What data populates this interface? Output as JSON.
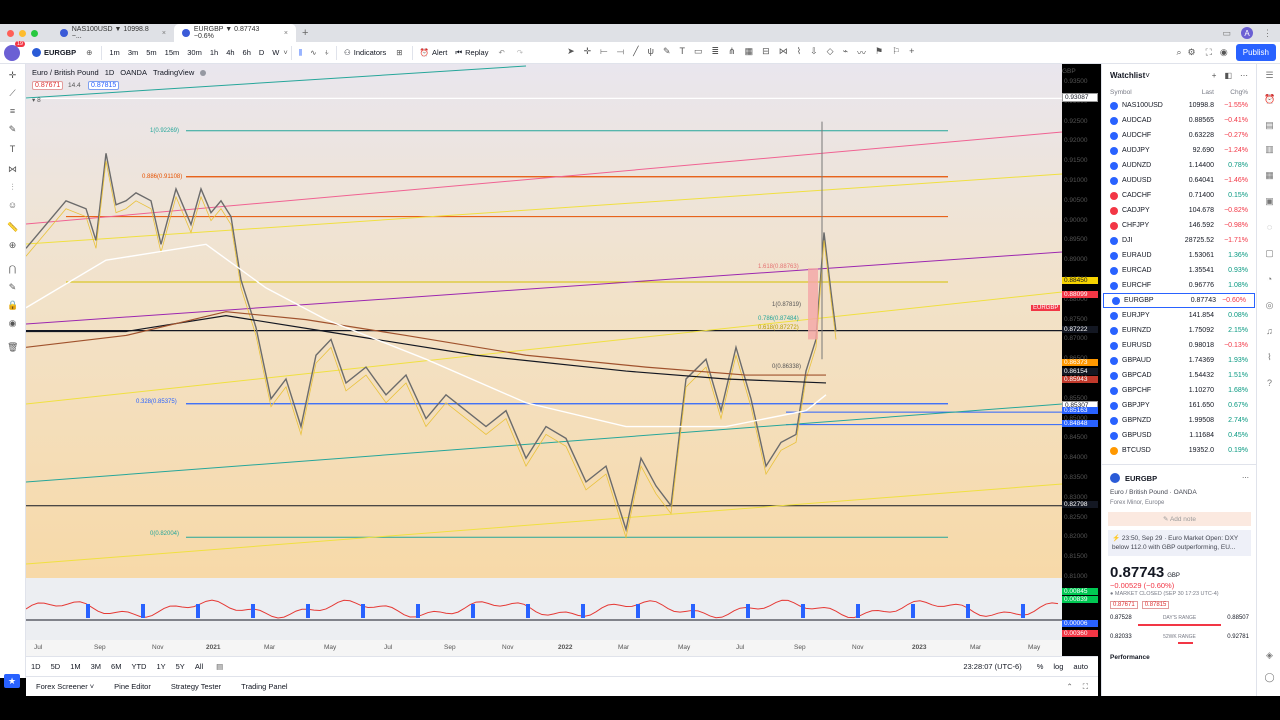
{
  "browser": {
    "tabs": [
      {
        "label": "NAS100USD ▼ 10998.8 −...",
        "active": false
      },
      {
        "label": "EURGBP ▼ 0.87743 −0.6%",
        "active": true
      }
    ],
    "new_tab": "+",
    "avatar_letter": "A"
  },
  "toolbar": {
    "symbol": "EURGBP",
    "intervals": [
      "1m",
      "3m",
      "5m",
      "15m",
      "30m",
      "1h",
      "4h",
      "6h",
      "D",
      "W"
    ],
    "indicators_label": "Indicators",
    "alert_label": "Alert",
    "replay_label": "Replay",
    "publish_label": "Publish",
    "notif_count": "19"
  },
  "chart": {
    "legend_title": "Euro / British Pound",
    "legend_interval": "1D",
    "legend_source": "OANDA",
    "legend_brand": "TradingView",
    "bid": "0.87671",
    "spread": "14.4",
    "ask": "0.87815",
    "indicator_count": "8",
    "currency": "GBP",
    "fib_labels": [
      "1(0.92269)",
      "0.886(0.91108)",
      "1.618(0.88763)",
      "1(0.87819)",
      "0.786(0.87484)",
      "0.618(0.87272)",
      "0(0.86338)",
      "0.328(0.85375)",
      "0(0.82004)"
    ],
    "price_ticks": [
      "0.93500",
      "0.93000",
      "0.92500",
      "0.92000",
      "0.91500",
      "0.91000",
      "0.90500",
      "0.90000",
      "0.89500",
      "0.89000",
      "0.88500",
      "0.88000",
      "0.87500",
      "0.87000",
      "0.86500",
      "0.86000",
      "0.85500",
      "0.85000",
      "0.84500",
      "0.84000",
      "0.83500",
      "0.83000",
      "0.82500",
      "0.82000",
      "0.81500",
      "0.81000"
    ],
    "price_tags": [
      {
        "text": "0.93087",
        "color": "#ffffff"
      },
      {
        "text": "0.88450",
        "color": "#f7d400"
      },
      {
        "text": "0.88099",
        "color": "#f23645"
      },
      {
        "text": "0.87222",
        "color": "#131722"
      },
      {
        "text": "0.86373",
        "color": "#ff9800"
      },
      {
        "text": "0.86154",
        "color": "#131722"
      },
      {
        "text": "0.85943",
        "color": "#c0392b"
      },
      {
        "text": "0.85307",
        "color": "#ffffff"
      },
      {
        "text": "0.85163",
        "color": "#2962ff"
      },
      {
        "text": "0.84848",
        "color": "#2962ff"
      },
      {
        "text": "0.82798",
        "color": "#131722"
      }
    ],
    "symbol_tag": "EURGBP",
    "osc_tags": [
      "0.00845",
      "0.00839",
      "0.00006",
      "0.00360"
    ],
    "time_ticks": [
      "Jul",
      "Sep",
      "Nov",
      "2021",
      "Mar",
      "May",
      "Jul",
      "Sep",
      "Nov",
      "2022",
      "Mar",
      "May",
      "Jul",
      "Sep",
      "Nov",
      "2023",
      "Mar",
      "May"
    ]
  },
  "range_bar": {
    "ranges": [
      "1D",
      "5D",
      "1M",
      "3M",
      "6M",
      "YTD",
      "1Y",
      "5Y",
      "All"
    ],
    "clock": "23:28:07 (UTC-6)",
    "pct": "%",
    "log": "log",
    "auto": "auto"
  },
  "bottom_panel": {
    "tabs": [
      "Forex Screener",
      "Pine Editor",
      "Strategy Tester",
      "Trading Panel"
    ]
  },
  "watchlist": {
    "title": "Watchlist",
    "col_symbol": "Symbol",
    "col_last": "Last",
    "col_chg": "Chg%",
    "rows": [
      {
        "sym": "NAS100USD",
        "last": "10998.8",
        "chg": "−1.55%",
        "dir": "dn",
        "ico": "#2962ff"
      },
      {
        "sym": "AUDCAD",
        "last": "0.88565",
        "chg": "−0.41%",
        "dir": "dn",
        "ico": "#2962ff"
      },
      {
        "sym": "AUDCHF",
        "last": "0.63228",
        "chg": "−0.27%",
        "dir": "dn",
        "ico": "#2962ff"
      },
      {
        "sym": "AUDJPY",
        "last": "92.690",
        "chg": "−1.24%",
        "dir": "dn",
        "ico": "#2962ff"
      },
      {
        "sym": "AUDNZD",
        "last": "1.14400",
        "chg": "0.78%",
        "dir": "up",
        "ico": "#2962ff"
      },
      {
        "sym": "AUDUSD",
        "last": "0.64041",
        "chg": "−1.46%",
        "dir": "dn",
        "ico": "#2962ff"
      },
      {
        "sym": "CADCHF",
        "last": "0.71400",
        "chg": "0.15%",
        "dir": "up",
        "ico": "#f23645"
      },
      {
        "sym": "CADJPY",
        "last": "104.678",
        "chg": "−0.82%",
        "dir": "dn",
        "ico": "#f23645"
      },
      {
        "sym": "CHFJPY",
        "last": "146.592",
        "chg": "−0.98%",
        "dir": "dn",
        "ico": "#f23645"
      },
      {
        "sym": "DJI",
        "last": "28725.52",
        "chg": "−1.71%",
        "dir": "dn",
        "ico": "#2962ff"
      },
      {
        "sym": "EURAUD",
        "last": "1.53061",
        "chg": "1.36%",
        "dir": "up",
        "ico": "#2962ff"
      },
      {
        "sym": "EURCAD",
        "last": "1.35541",
        "chg": "0.93%",
        "dir": "up",
        "ico": "#2962ff"
      },
      {
        "sym": "EURCHF",
        "last": "0.96776",
        "chg": "1.08%",
        "dir": "up",
        "ico": "#2962ff"
      },
      {
        "sym": "EURGBP",
        "last": "0.87743",
        "chg": "−0.60%",
        "dir": "dn",
        "ico": "#2962ff",
        "sel": true
      },
      {
        "sym": "EURJPY",
        "last": "141.854",
        "chg": "0.08%",
        "dir": "up",
        "ico": "#2962ff"
      },
      {
        "sym": "EURNZD",
        "last": "1.75092",
        "chg": "2.15%",
        "dir": "up",
        "ico": "#2962ff"
      },
      {
        "sym": "EURUSD",
        "last": "0.98018",
        "chg": "−0.13%",
        "dir": "dn",
        "ico": "#2962ff"
      },
      {
        "sym": "GBPAUD",
        "last": "1.74369",
        "chg": "1.93%",
        "dir": "up",
        "ico": "#2962ff"
      },
      {
        "sym": "GBPCAD",
        "last": "1.54432",
        "chg": "1.51%",
        "dir": "up",
        "ico": "#2962ff"
      },
      {
        "sym": "GBPCHF",
        "last": "1.10270",
        "chg": "1.68%",
        "dir": "up",
        "ico": "#2962ff"
      },
      {
        "sym": "GBPJPY",
        "last": "161.650",
        "chg": "0.67%",
        "dir": "up",
        "ico": "#2962ff"
      },
      {
        "sym": "GBPNZD",
        "last": "1.99508",
        "chg": "2.74%",
        "dir": "up",
        "ico": "#2962ff"
      },
      {
        "sym": "GBPUSD",
        "last": "1.11684",
        "chg": "0.45%",
        "dir": "up",
        "ico": "#2962ff"
      },
      {
        "sym": "BTCUSD",
        "last": "19352.0",
        "chg": "0.19%",
        "dir": "up",
        "ico": "#ff9800"
      }
    ]
  },
  "detail": {
    "symbol": "EURGBP",
    "name": "Euro / British Pound · OANDA",
    "sub": "Forex Minor, Europe",
    "add_note": "Add note",
    "news": "23:50, Sep 29 · Euro Market Open: DXY below 112.0 with GBP outperforming, EU...",
    "price": "0.87743",
    "currency": "GBP",
    "change": "−0.00529 (−0.60%)",
    "closed": "MARKET CLOSED (SEP 30 17:23 UTC-4)",
    "bid": "0.87671",
    "ask": "0.87815",
    "day_low": "0.87528",
    "day_range": "DAY'S RANGE",
    "day_high": "0.88507",
    "wk_low": "0.82033",
    "wk_range": "52WK RANGE",
    "wk_high": "0.92781",
    "performance": "Performance"
  }
}
